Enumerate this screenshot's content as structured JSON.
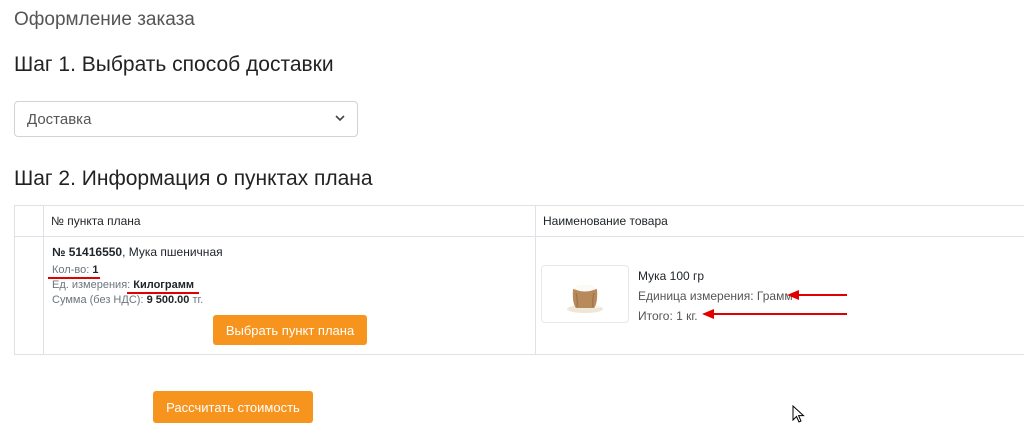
{
  "page": {
    "title": "Оформление заказа"
  },
  "step1": {
    "heading": "Шаг 1. Выбрать способ доставки",
    "delivery_selected": "Доставка"
  },
  "step2": {
    "heading": "Шаг 2. Информация о пунктах плана",
    "columns": [
      "№ пункта плана",
      "Наименование товара"
    ],
    "row": {
      "number_prefix": "№ 51416550",
      "item_name": ", Мука пшеничная",
      "qty_label": "Кол-во:",
      "qty_value": "1",
      "unit_label": "Ед. измерения:",
      "unit_value": "Килограмм",
      "sum_label": "Сумма (без НДС):",
      "sum_value": "9 500.00",
      "currency": "тг.",
      "select_button": "Выбрать пункт плана",
      "product_name": "Мука 100 гр",
      "product_unit": "Единица измерения: Грамм",
      "product_total": "Итого: 1 кг."
    }
  },
  "calc_button": "Рассчитать стоимость",
  "colors": {
    "accent": "#f7941d",
    "annotation": "#e00000"
  }
}
